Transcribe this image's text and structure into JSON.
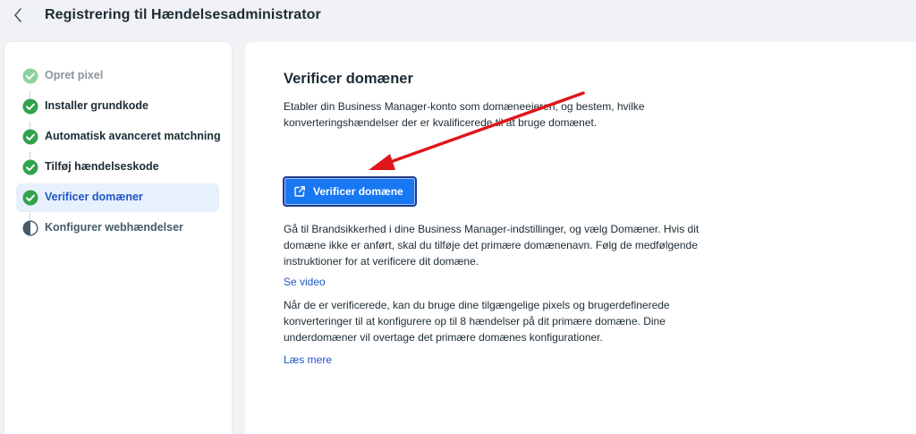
{
  "header": {
    "title": "Registrering til Hændelsesadministrator",
    "back_icon": "chevron-left-icon"
  },
  "sidebar": {
    "steps": [
      {
        "label": "Opret pixel",
        "state": "done-muted"
      },
      {
        "label": "Installer grundkode",
        "state": "done"
      },
      {
        "label": "Automatisk avanceret matchning",
        "state": "done"
      },
      {
        "label": "Tilføj hændelseskode",
        "state": "done"
      },
      {
        "label": "Verificer domæner",
        "state": "active"
      },
      {
        "label": "Konfigurer webhændelser",
        "state": "pending"
      }
    ]
  },
  "main": {
    "title": "Verificer domæner",
    "intro": "Etabler din Business Manager-konto som domæneejeren, og bestem, hvilke konverteringshændelser der er kvalificerede til at bruge domænet.",
    "button_label": "Verificer domæne",
    "instructions": "Gå til Brandsikkerhed i dine Business Manager-indstillinger, og vælg Domæner. Hvis dit domæne ikke er anført, skal du tilføje det primære domænenavn. Følg de medfølgende instruktioner for at verificere dit domæne.",
    "video_link": "Se video",
    "after_verify": "Når de er verificerede, kan du bruge dine tilgængelige pixels og brugerdefinerede konverteringer til at konfigurere op til 8 hændelser på dit primære domæne. Dine underdomæner vil overtage det primære domænes konfigurationer.",
    "read_more_link": "Læs mere"
  },
  "colors": {
    "check_green": "#31a24c",
    "check_muted": "#8fd19e",
    "accent_blue": "#1877f2",
    "active_bg": "#e7f0fd",
    "annotation_arrow": "#e0161b"
  }
}
